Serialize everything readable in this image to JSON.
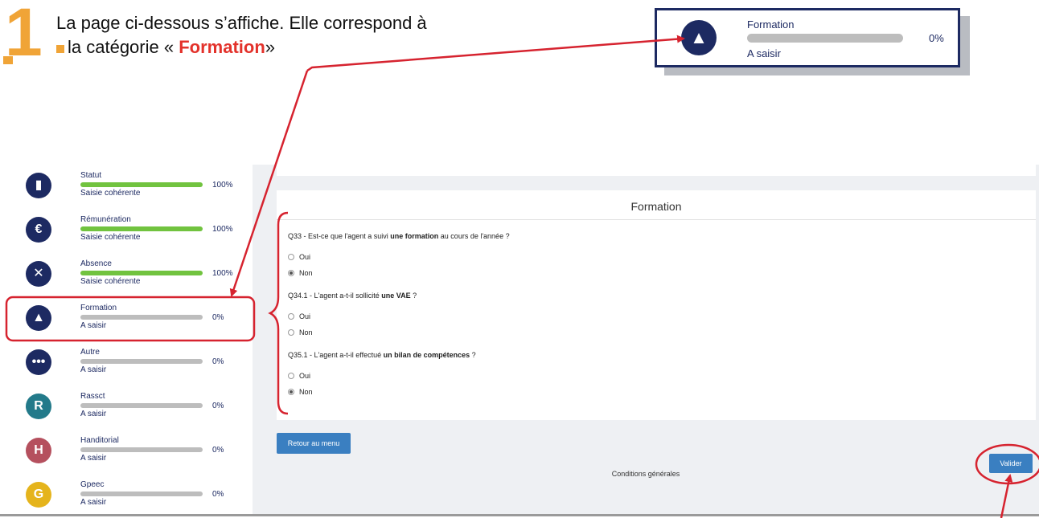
{
  "instruction": {
    "number": "1",
    "line1": "La page ci-dessous s’affiche. Elle correspond à",
    "line2_prefix": "la catégorie « ",
    "line2_highlight": "Formation",
    "line2_suffix": "»"
  },
  "callout": {
    "title": "Formation",
    "percent": "0%",
    "status": "A saisir",
    "icon": "graduation-cap-icon"
  },
  "sidebar": {
    "items": [
      {
        "label": "Statut",
        "status": "Saisie cohérente",
        "percent": "100%",
        "progress": 1.0,
        "icon": "briefcase-icon",
        "icon_glyph": "▮",
        "color": "#1d2a62"
      },
      {
        "label": "Rémunération",
        "status": "Saisie cohérente",
        "percent": "100%",
        "progress": 1.0,
        "icon": "euro-icon",
        "icon_glyph": "€",
        "color": "#1d2a62"
      },
      {
        "label": "Absence",
        "status": "Saisie cohérente",
        "percent": "100%",
        "progress": 1.0,
        "icon": "user-x-icon",
        "icon_glyph": "✕",
        "color": "#1d2a62"
      },
      {
        "label": "Formation",
        "status": "A saisir",
        "percent": "0%",
        "progress": 0.0,
        "icon": "graduation-cap-icon",
        "icon_glyph": "▲",
        "color": "#1d2a62"
      },
      {
        "label": "Autre",
        "status": "A saisir",
        "percent": "0%",
        "progress": 0.0,
        "icon": "ellipsis-icon",
        "icon_glyph": "•••",
        "color": "#1d2a62"
      },
      {
        "label": "Rassct",
        "status": "A saisir",
        "percent": "0%",
        "progress": 0.0,
        "icon": "letter-r-icon",
        "icon_glyph": "R",
        "color": "#237a8a"
      },
      {
        "label": "Handitorial",
        "status": "A saisir",
        "percent": "0%",
        "progress": 0.0,
        "icon": "letter-h-icon",
        "icon_glyph": "H",
        "color": "#b5505e"
      },
      {
        "label": "Gpeec",
        "status": "A saisir",
        "percent": "0%",
        "progress": 0.0,
        "icon": "letter-g-icon",
        "icon_glyph": "G",
        "color": "#e5b41c"
      }
    ]
  },
  "form": {
    "title": "Formation",
    "questions": [
      {
        "prefix": "Q33 - Est-ce que l'agent a suivi ",
        "bold": "une formation",
        "suffix": " au cours de l'année ?",
        "options": [
          "Oui",
          "Non"
        ],
        "selected": "Non"
      },
      {
        "prefix": "Q34.1 - L'agent a-t-il sollicité ",
        "bold": "une VAE",
        "suffix": " ?",
        "options": [
          "Oui",
          "Non"
        ],
        "selected": ""
      },
      {
        "prefix": "Q35.1 - L'agent a-t-il effectué ",
        "bold": "un bilan de compétences",
        "suffix": " ?",
        "options": [
          "Oui",
          "Non"
        ],
        "selected": "Non"
      }
    ]
  },
  "buttons": {
    "back": "Retour au menu",
    "validate": "Valider"
  },
  "footer": {
    "conditions": "Conditions générales"
  },
  "colors": {
    "accent_orange": "#f0a437",
    "highlight_red": "#e3322b",
    "navy": "#1d2a62",
    "button_blue": "#3a7fc1",
    "progress_green": "#71c33f"
  }
}
